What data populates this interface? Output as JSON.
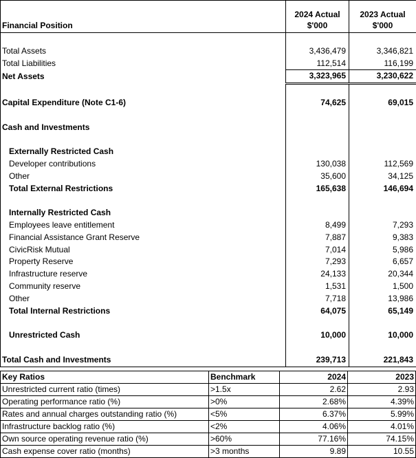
{
  "financial_position": {
    "header": {
      "title": "Financial Position",
      "col_2024": "2024 Actual\n$'000",
      "col_2023": "2023 Actual\n$'000"
    },
    "rows": [
      {
        "label": "",
        "y2024": "",
        "y2023": ""
      },
      {
        "label": "Total Assets",
        "y2024": "3,436,479",
        "y2023": "3,346,821"
      },
      {
        "label": "Total Liabilities",
        "y2024": "112,514",
        "y2023": "116,199"
      },
      {
        "label": "Net Assets",
        "y2024": "3,323,965",
        "y2023": "3,230,622"
      },
      {
        "label": "",
        "y2024": "",
        "y2023": ""
      },
      {
        "label": "Capital Expenditure (Note C1-6)",
        "y2024": "74,625",
        "y2023": "69,015"
      },
      {
        "label": "",
        "y2024": "",
        "y2023": ""
      },
      {
        "label": "Cash and Investments",
        "y2024": "",
        "y2023": ""
      },
      {
        "label": "",
        "y2024": "",
        "y2023": ""
      },
      {
        "label": "Externally Restricted Cash",
        "y2024": "",
        "y2023": ""
      },
      {
        "label": "Developer contributions",
        "y2024": "130,038",
        "y2023": "112,569"
      },
      {
        "label": "Other",
        "y2024": "35,600",
        "y2023": "34,125"
      },
      {
        "label": "Total External Restrictions",
        "y2024": "165,638",
        "y2023": "146,694"
      },
      {
        "label": "",
        "y2024": "",
        "y2023": ""
      },
      {
        "label": "Internally Restricted Cash",
        "y2024": "",
        "y2023": ""
      },
      {
        "label": "Employees leave entitlement",
        "y2024": "8,499",
        "y2023": "7,293"
      },
      {
        "label": "Financial Assistance Grant Reserve",
        "y2024": "7,887",
        "y2023": "9,383"
      },
      {
        "label": "CivicRisk Mutual",
        "y2024": "7,014",
        "y2023": "5,986"
      },
      {
        "label": "Property Reserve",
        "y2024": "7,293",
        "y2023": "6,657"
      },
      {
        "label": "Infrastructure reserve",
        "y2024": "24,133",
        "y2023": "20,344"
      },
      {
        "label": "Community reserve",
        "y2024": "1,531",
        "y2023": "1,500"
      },
      {
        "label": "Other",
        "y2024": "7,718",
        "y2023": "13,986"
      },
      {
        "label": "Total Internal Restrictions",
        "y2024": "64,075",
        "y2023": "65,149"
      },
      {
        "label": "",
        "y2024": "",
        "y2023": ""
      },
      {
        "label": "Unrestricted Cash",
        "y2024": "10,000",
        "y2023": "10,000"
      },
      {
        "label": "",
        "y2024": "",
        "y2023": ""
      },
      {
        "label": "Total Cash and Investments",
        "y2024": "239,713",
        "y2023": "221,843"
      }
    ]
  },
  "key_ratios": {
    "header": {
      "title": "Key Ratios",
      "benchmark": "Benchmark",
      "y2024": "2024",
      "y2023": "2023"
    },
    "rows": [
      {
        "label": "Unrestricted current ratio (times)",
        "benchmark": ">1.5x",
        "y2024": "2.62",
        "y2023": "2.93"
      },
      {
        "label": "Operating performance ratio (%)",
        "benchmark": ">0%",
        "y2024": "2.68%",
        "y2023": "4.39%"
      },
      {
        "label": "Rates and annual charges outstanding ratio (%)",
        "benchmark": "<5%",
        "y2024": "6.37%",
        "y2023": "5.99%"
      },
      {
        "label": "Infrastructure backlog ratio (%)",
        "benchmark": "<2%",
        "y2024": "4.06%",
        "y2023": "4.01%"
      },
      {
        "label": "Own source operating revenue ratio (%)",
        "benchmark": ">60%",
        "y2024": "77.16%",
        "y2023": "74.15%"
      },
      {
        "label": "Cash expense cover ratio (months)",
        "benchmark": ">3 months",
        "y2024": "9.89",
        "y2023": "10.55"
      }
    ]
  }
}
